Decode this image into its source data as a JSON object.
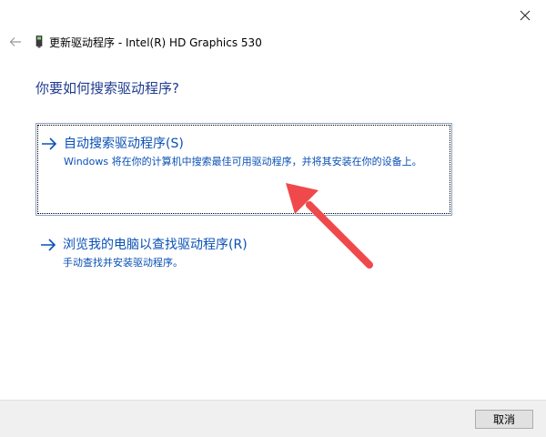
{
  "window": {
    "title": "更新驱动程序 - Intel(R) HD Graphics 530"
  },
  "heading": "你要如何搜索驱动程序?",
  "options": [
    {
      "title": "自动搜索驱动程序(S)",
      "description": "Windows 将在你的计算机中搜索最佳可用驱动程序，并将其安装在你的设备上。"
    },
    {
      "title": "浏览我的电脑以查找驱动程序(R)",
      "description": "手动查找并安装驱动程序。"
    }
  ],
  "footer": {
    "cancel_label": "取消"
  },
  "colors": {
    "heading": "#1f3c8f",
    "link": "#0a51b5",
    "annotation_arrow": "#f0494b",
    "footer_bg": "#f0f0f0"
  },
  "icons": {
    "close": "close-icon",
    "back": "back-arrow-icon",
    "device": "device-icon",
    "option_arrow": "arrow-right-icon",
    "annotation": "red-pointer-arrow-icon"
  }
}
